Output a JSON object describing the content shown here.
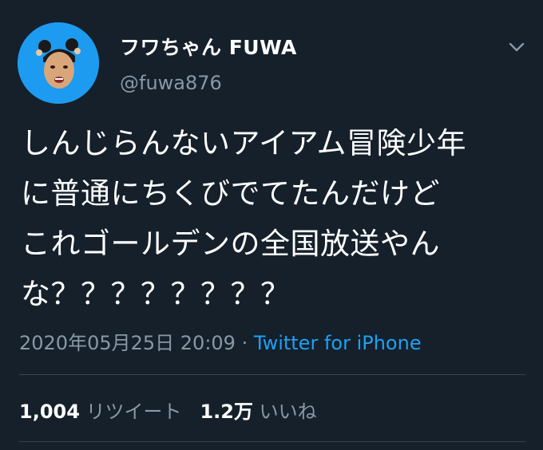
{
  "author": {
    "display_name": "フワちゃん FUWA",
    "handle": "@fuwa876",
    "avatar_icon": "avatar-photo-icon",
    "avatar_bg_color": "#1d9bf0"
  },
  "tweet": {
    "text_lines": [
      "しんじらんないアイアム冒険少年",
      "に普通にちくびでてたんだけど",
      "これゴールデンの全国放送やん",
      "な？？？？？？？？"
    ],
    "timestamp": "2020年05月25日 20:09",
    "separator": "·",
    "source": "Twitter for iPhone"
  },
  "stats": {
    "retweets_count": "1,004",
    "retweets_label": "リツイート",
    "likes_count": "1.2万",
    "likes_label": "いいね"
  },
  "colors": {
    "background": "#15202b",
    "secondary_text": "#8899a6",
    "link": "#1da1f2",
    "divider": "#38444d"
  },
  "icons": {
    "menu": "chevron-down-icon"
  }
}
